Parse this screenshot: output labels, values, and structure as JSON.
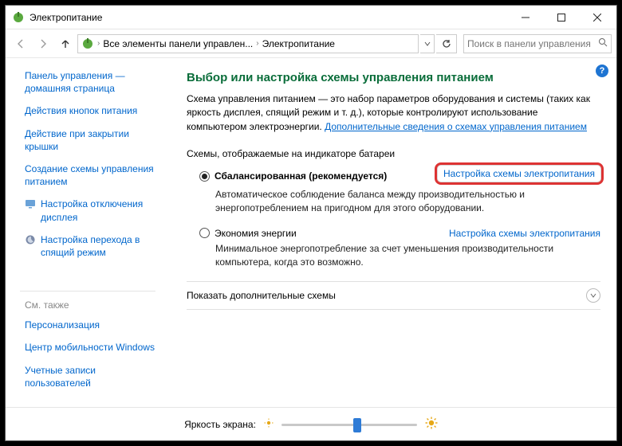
{
  "window": {
    "title": "Электропитание"
  },
  "addressbar": {
    "segments": [
      "Все элементы панели управлен...",
      "Электропитание"
    ]
  },
  "search": {
    "placeholder": "Поиск в панели управления"
  },
  "sidebar": {
    "home": "Панель управления — домашняя страница",
    "links": [
      "Действия кнопок питания",
      "Действие при закрытии крышки",
      "Создание схемы управления питанием"
    ],
    "icon_links": [
      "Настройка отключения дисплея",
      "Настройка перехода в спящий режим"
    ],
    "see_also_header": "См. также",
    "see_also": [
      "Персонализация",
      "Центр мобильности Windows",
      "Учетные записи пользователей"
    ]
  },
  "main": {
    "heading": "Выбор или настройка схемы управления питанием",
    "desc_a": "Схема управления питанием — это набор параметров оборудования и системы (таких как яркость дисплея, спящий режим и т. д.), которые контролируют использование компьютером электроэнергии. ",
    "desc_link": "Дополнительные сведения о схемах управления питанием",
    "section": "Схемы, отображаемые на индикаторе батареи",
    "plan1": {
      "name": "Сбалансированная (рекомендуется)",
      "config": "Настройка схемы электропитания",
      "desc": "Автоматическое соблюдение баланса между производительностью и энергопотреблением на пригодном для этого оборудовании."
    },
    "plan2": {
      "name": "Экономия энергии",
      "config": "Настройка схемы электропитания",
      "desc": "Минимальное энергопотребление за счет уменьшения производительности компьютера, когда это возможно."
    },
    "show_more": "Показать дополнительные схемы"
  },
  "footer": {
    "brightness_label": "Яркость экрана:",
    "brightness_value": 56
  }
}
